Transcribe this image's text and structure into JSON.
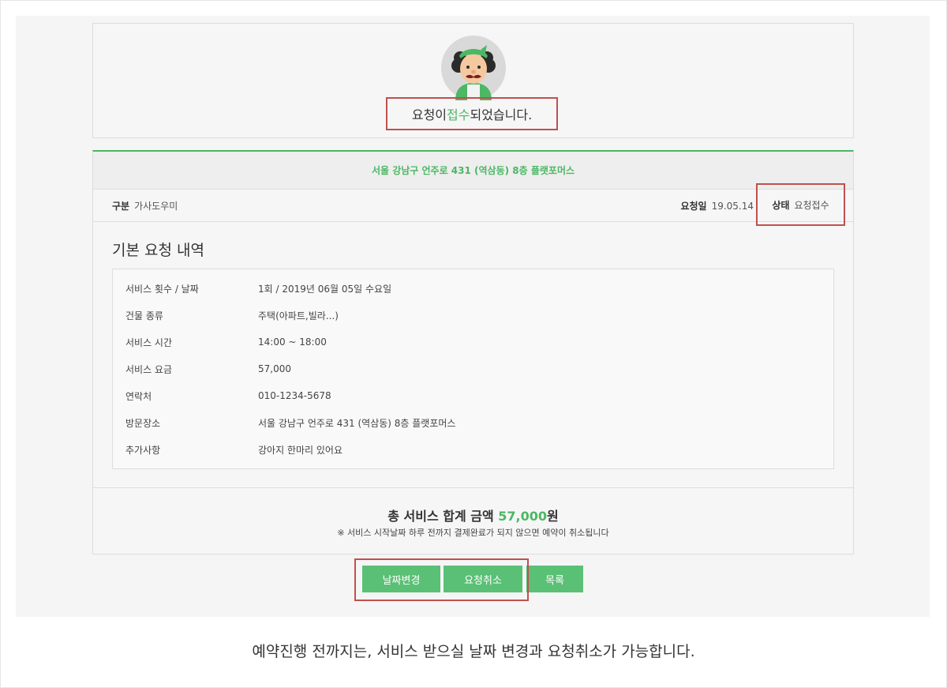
{
  "header": {
    "message_prefix": "요청이 ",
    "message_highlight": "접수",
    "message_suffix": "되었습니다."
  },
  "address_bar": {
    "text": "서울 강남구 언주로 431 (역삼동) 8층 플랫포머스"
  },
  "meta": {
    "category_label": "구분",
    "category_value": "가사도우미",
    "request_date_label": "요청일",
    "request_date_value": "19.05.14",
    "status_label": "상태",
    "status_value": "요청접수"
  },
  "section": {
    "title": "기본 요청 내역"
  },
  "details": [
    {
      "label": "서비스 횟수 / 날짜",
      "value": "1회 / 2019년 06월 05일 수요일"
    },
    {
      "label": "건물 종류",
      "value": "주택(아파트,빌라...)"
    },
    {
      "label": "서비스 시간",
      "value": "14:00 ~ 18:00"
    },
    {
      "label": "서비스 요금",
      "value": "57,000"
    },
    {
      "label": "연락처",
      "value": "010-1234-5678"
    },
    {
      "label": "방문장소",
      "value": "서울 강남구 언주로 431 (역삼동) 8층 플랫포머스"
    },
    {
      "label": "추가사항",
      "value": "강아지 한마리 있어요"
    }
  ],
  "total": {
    "label": "총 서비스 합계 금액 ",
    "amount": "57,000",
    "unit": "원",
    "note": "※ 서비스 시작날짜 하루 전까지 결제완료가 되지 않으면 예약이 취소됩니다"
  },
  "buttons": {
    "change_date": "날짜변경",
    "cancel_request": "요청취소",
    "list": "목록"
  },
  "caption": "예약진행 전까지는, 서비스 받으실 날짜 변경과 요청취소가 가능합니다.",
  "colors": {
    "accent": "#4cb764",
    "button": "#5ac075",
    "highlight_border": "#c0504d"
  }
}
